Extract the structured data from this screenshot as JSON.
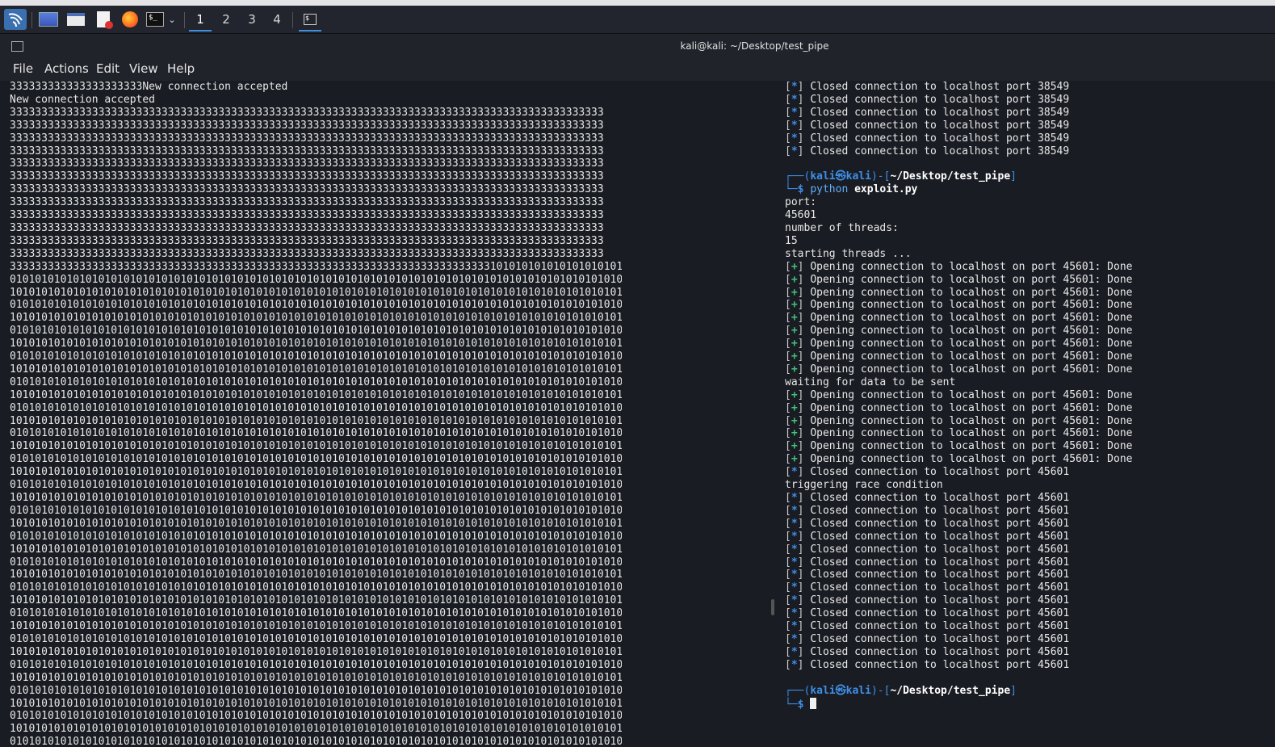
{
  "taskbar": {
    "workspaces": [
      "1",
      "2",
      "3",
      "4"
    ],
    "icons": [
      "kali-menu-icon",
      "desktop-icon",
      "file-manager-icon",
      "text-editor-icon",
      "firefox-icon",
      "terminal-icon",
      "dropdown-icon",
      "active-terminal-icon"
    ]
  },
  "window": {
    "title": "kali@kali: ~/Desktop/test_pipe",
    "menu": [
      "File",
      "Actions",
      "Edit",
      "View",
      "Help"
    ]
  },
  "left_pane": {
    "line1": "333333333333333333333New connection accepted",
    "line2": "New connection accepted",
    "threes_row": "3333333333333333333333333333333333333333333333333333333333333333333333333333333333333333333333",
    "threes_rows_count_note": "",
    "mixed_row": "3333333333333333333333333333333333333333333333333333333333333333333333333333101010101010101010101",
    "row_a": "0101010101010101010101010101010101010101010101010101010101010101010101010101010101010101010101010",
    "row_b": "1010101010101010101010101010101010101010101010101010101010101010101010101010101010101010101010101"
  },
  "right_pane": {
    "closed_38549": "Closed connection to localhost port 38549",
    "prompt_user": "kali",
    "prompt_host": "kali",
    "prompt_path": "~/Desktop/test_pipe",
    "cmd_python": "python",
    "cmd_file": "exploit.py",
    "port_label": "port:",
    "port_value": "45601",
    "threads_label": "number of threads:",
    "threads_value": "15",
    "starting": "starting threads ...",
    "opening": "Opening connection to localhost on port 45601: Done",
    "waiting": "waiting for data to be sent",
    "closed_45601": "Closed connection to localhost port 45601",
    "triggering": "triggering race condition"
  }
}
